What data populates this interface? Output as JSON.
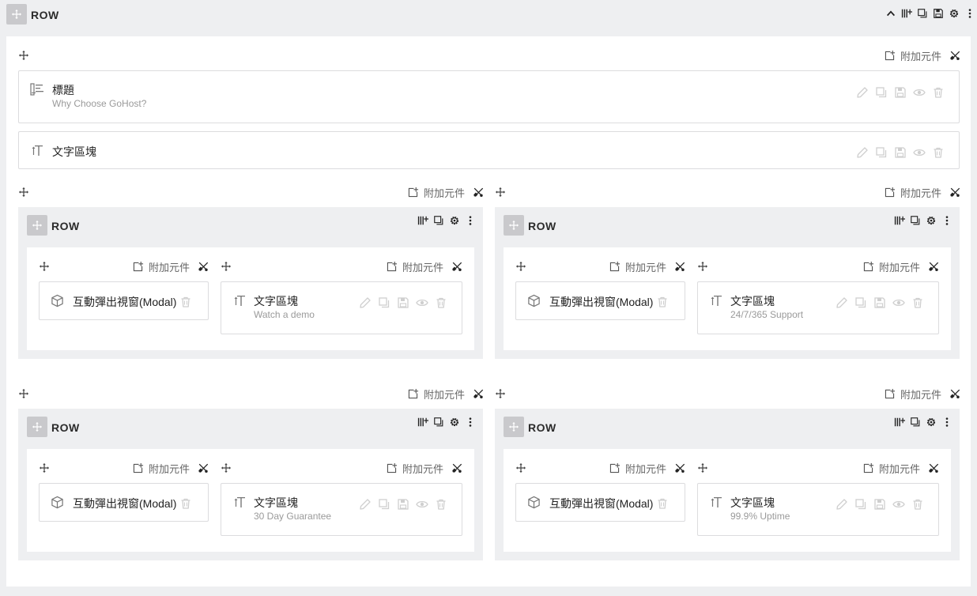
{
  "row_label": "ROW",
  "add_component_label": "附加元件",
  "top_cards": [
    {
      "title": "標題",
      "subtitle": "Why Choose GoHost?"
    },
    {
      "title": "文字區塊",
      "subtitle": ""
    }
  ],
  "blocks": [
    {
      "modal_title": "互動彈出視窗(Modal)",
      "text_title": "文字區塊",
      "text_sub": "Watch a demo"
    },
    {
      "modal_title": "互動彈出視窗(Modal)",
      "text_title": "文字區塊",
      "text_sub": "24/7/365 Support"
    },
    {
      "modal_title": "互動彈出視窗(Modal)",
      "text_title": "文字區塊",
      "text_sub": "30 Day Guarantee"
    },
    {
      "modal_title": "互動彈出視窗(Modal)",
      "text_title": "文字區塊",
      "text_sub": "99.9% Uptime"
    }
  ]
}
